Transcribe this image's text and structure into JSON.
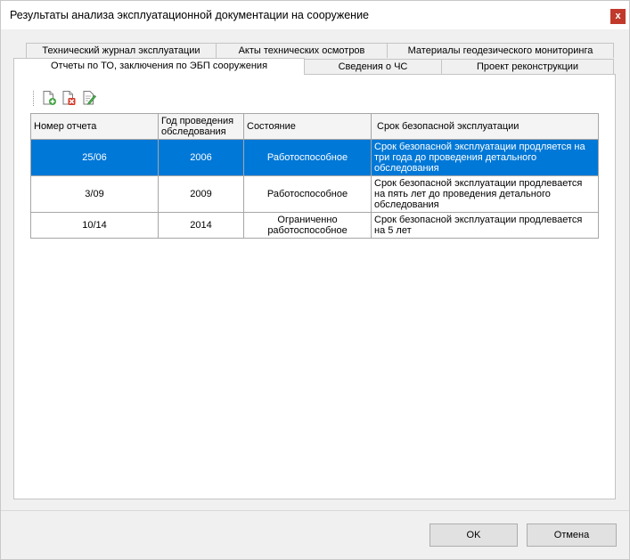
{
  "window": {
    "title": "Результаты анализа эксплуатационной документации на сооружение",
    "close_label": "x"
  },
  "tabs": {
    "row_top": [
      {
        "label": "Технический журнал эксплуатации"
      },
      {
        "label": "Акты технических осмотров"
      },
      {
        "label": "Материалы геодезического мониторинга"
      }
    ],
    "row_bottom": [
      {
        "label": "Отчеты по ТО, заключения по ЭБП сооружения",
        "active": true
      },
      {
        "label": "Сведения о ЧС"
      },
      {
        "label": "Проект реконструкции"
      }
    ]
  },
  "toolbar": {
    "buttons": [
      {
        "icon": "add-document-icon"
      },
      {
        "icon": "delete-document-icon"
      },
      {
        "icon": "edit-document-icon"
      }
    ]
  },
  "table": {
    "columns": [
      "Номер отчета",
      "Год проведения обследования",
      "Состояние",
      "Срок безопасной эксплуатации"
    ],
    "rows": [
      {
        "number": "25/06",
        "year": "2006",
        "state": "Работоспособное",
        "term": "Срок безопасной эксплуатации продляется на три года до проведения детального обследования",
        "selected": true
      },
      {
        "number": "3/09",
        "year": "2009",
        "state": "Работоспособное",
        "term": "Срок безопасной эксплуатации продлевается на пять лет до проведения детального обследования",
        "selected": false
      },
      {
        "number": "10/14",
        "year": "2014",
        "state": "Ограниченно работоспособное",
        "term": "Срок безопасной эксплуатации продлевается на 5 лет",
        "selected": false
      }
    ]
  },
  "footer": {
    "ok_label": "OK",
    "cancel_label": "Отмена"
  },
  "colors": {
    "selection": "#0078d7",
    "close_button": "#c0392b"
  }
}
